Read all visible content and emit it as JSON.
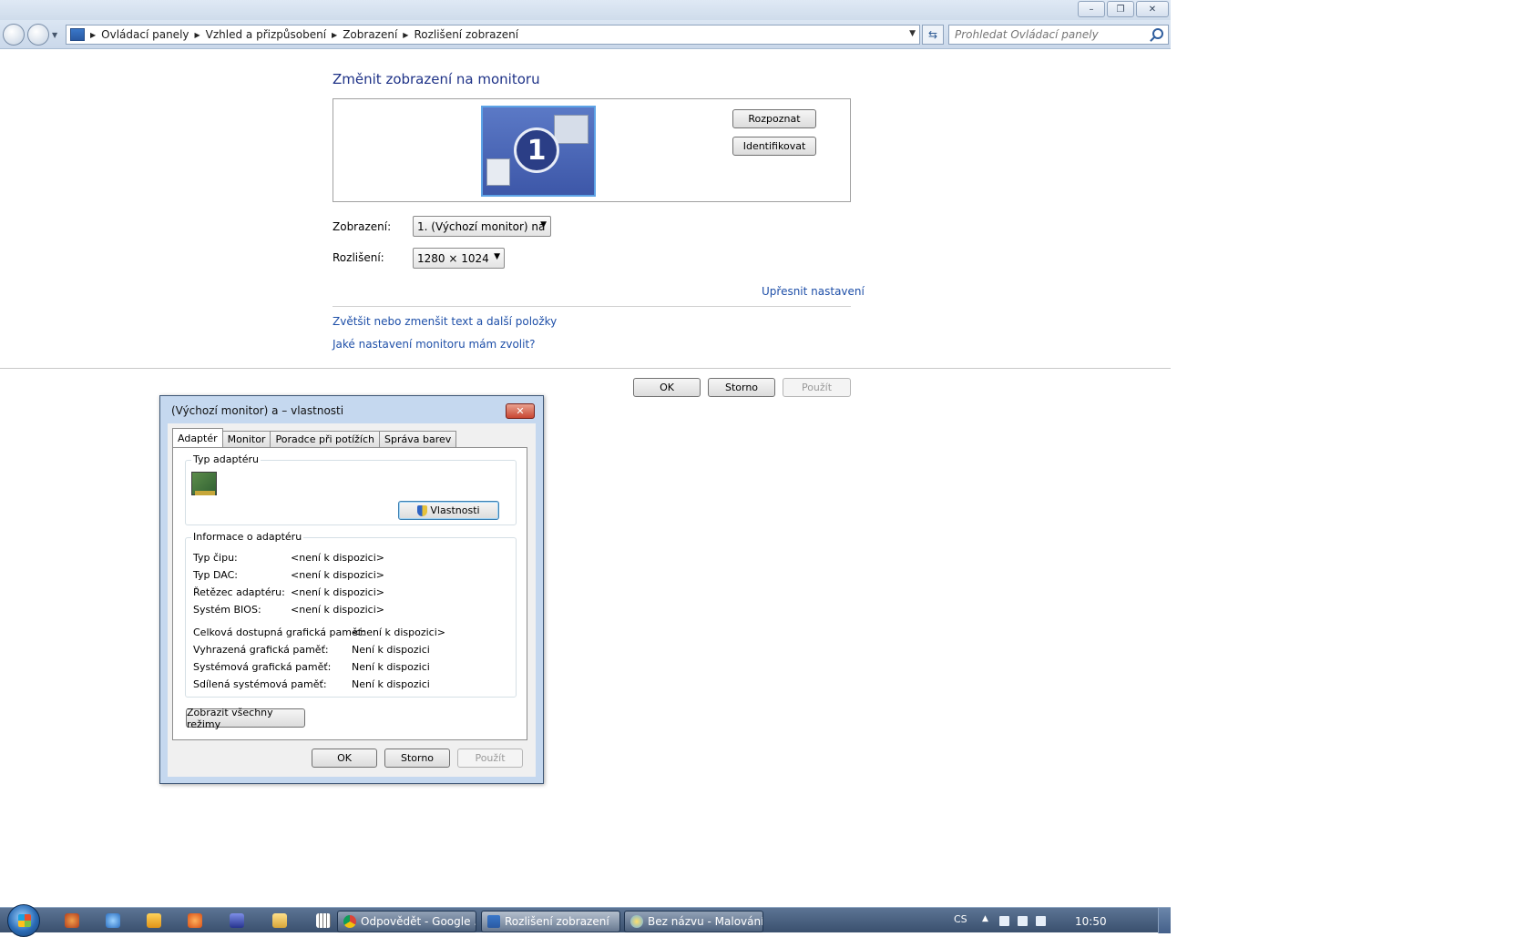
{
  "window": {
    "caption": {
      "minimize": "–",
      "restore": "❐",
      "close": "✕"
    }
  },
  "address_bar": {
    "breadcrumbs": [
      "Ovládací panely",
      "Vzhled a přizpůsobení",
      "Zobrazení",
      "Rozlišení zobrazení"
    ],
    "search_placeholder": "Prohledat Ovládací panely"
  },
  "main": {
    "title": "Změnit zobrazení na monitoru",
    "monitor_number": "1",
    "detect_button": "Rozpoznat",
    "identify_button": "Identifikovat",
    "display_label": "Zobrazení:",
    "display_value": "1. (Výchozí monitor) na",
    "resolution_label": "Rozlišení:",
    "resolution_value": "1280 × 1024",
    "advanced_link": "Upřesnit nastavení",
    "links": [
      "Zvětšit nebo zmenšit text a další položky",
      "Jaké nastavení monitoru mám zvolit?"
    ],
    "ok_button": "OK",
    "cancel_button": "Storno",
    "apply_button": "Použít"
  },
  "dialog": {
    "title": "(Výchozí monitor) a  – vlastnosti",
    "close": "✕",
    "tabs": [
      "Adaptér",
      "Monitor",
      "Poradce při potížích",
      "Správa barev"
    ],
    "adapter_type_group": "Typ adaptéru",
    "properties_button": "Vlastnosti",
    "adapter_info_group": "Informace o adaptéru",
    "info_rows": [
      {
        "label": "Typ čipu:",
        "value": "<není k dispozici>"
      },
      {
        "label": "Typ DAC:",
        "value": "<není k dispozici>"
      },
      {
        "label": "Řetězec adaptéru:",
        "value": "<není k dispozici>"
      },
      {
        "label": "Systém BIOS:",
        "value": "<není k dispozici>"
      }
    ],
    "memory_rows": [
      {
        "label": "Celková dostupná grafická paměť:",
        "value": "<není k dispozici>"
      },
      {
        "label": "Vyhrazená grafická paměť:",
        "value": "Není k dispozici"
      },
      {
        "label": "Systémová grafická paměť:",
        "value": "Není k dispozici"
      },
      {
        "label": "Sdílená systémová paměť:",
        "value": "Není k dispozici"
      }
    ],
    "show_modes_button": "Zobrazit všechny režimy",
    "ok_button": "OK",
    "cancel_button": "Storno",
    "apply_button": "Použít"
  },
  "taskbar": {
    "tasks": [
      "Odpovědět - Google ...",
      "Rozlišení zobrazení",
      "Bez názvu - Malování"
    ],
    "language": "CS",
    "time": "10:50"
  }
}
